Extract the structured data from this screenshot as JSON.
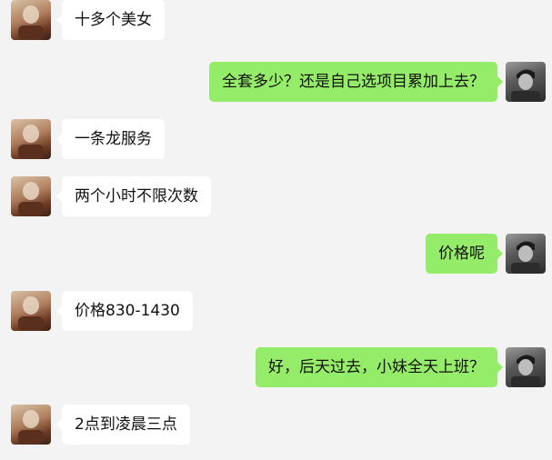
{
  "chat": {
    "messages": [
      {
        "side": "in",
        "text": "十多个美女"
      },
      {
        "side": "out",
        "text": "全套多少？还是自己选项目累加上去？"
      },
      {
        "side": "in",
        "text": "一条龙服务"
      },
      {
        "side": "in",
        "text": "两个小时不限次数"
      },
      {
        "side": "out",
        "text": "价格呢"
      },
      {
        "side": "in",
        "text": "价格830-1430"
      },
      {
        "side": "out",
        "text": "好，后天过去，小妹全天上班？"
      },
      {
        "side": "in",
        "text": "2点到凌晨三点"
      }
    ]
  },
  "colors": {
    "background": "#f3f3f3",
    "incoming_bubble": "#ffffff",
    "outgoing_bubble": "#95ec69"
  },
  "icons": {
    "contact_avatar": "contact-avatar-photo",
    "self_avatar": "self-avatar-photo"
  }
}
